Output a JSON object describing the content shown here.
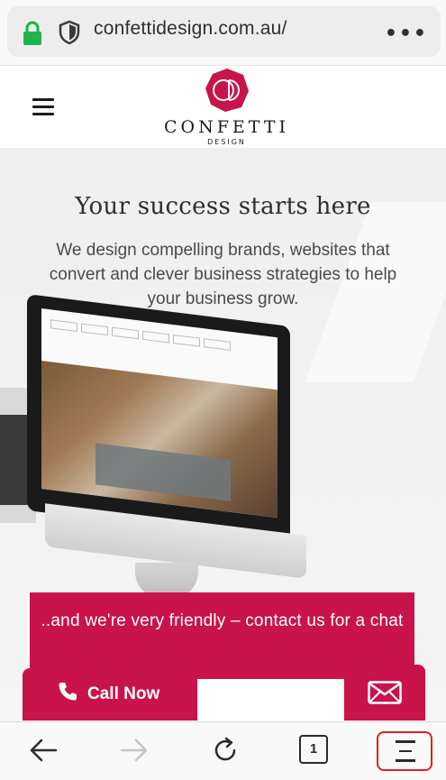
{
  "browser": {
    "url": "confettidesign.com.au/",
    "more_icon": "more-horizontal-icon"
  },
  "site": {
    "logo_name": "CONFETTI",
    "logo_sub": "DESIGN",
    "logo_color": "#c9134b"
  },
  "hero": {
    "title": "Your success starts here",
    "text": "We design compelling brands, websites that convert and clever business strategies to help your business grow."
  },
  "cta": {
    "text": "..and we're very friendly – contact us for a chat",
    "call_label": "Call Now"
  },
  "toolbar": {
    "tab_count": "1"
  },
  "colors": {
    "brand": "#c9134b",
    "highlight": "#e01f26"
  }
}
